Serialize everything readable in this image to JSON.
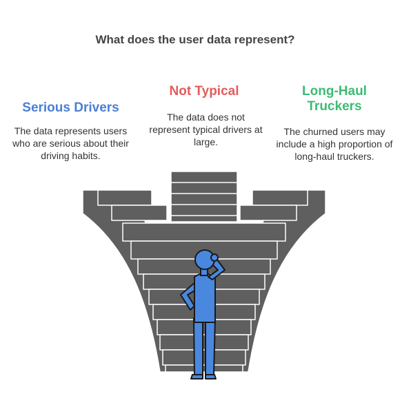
{
  "title": "What does the user data represent?",
  "items": [
    {
      "heading": "Serious Drivers",
      "description": "The data represents users who are serious about their driving habits.",
      "color": "#4a7fd4"
    },
    {
      "heading": "Not Typical",
      "description": "The data does not represent typical drivers at large.",
      "color": "#e25c5c"
    },
    {
      "heading": "Long-Haul Truckers",
      "description": "The churned users may include a high proportion of long-haul truckers.",
      "color": "#3dbb73"
    }
  ],
  "colors": {
    "stairs": "#5f5f5f",
    "edge": "#ffffff",
    "person": "#4a88e0",
    "outline": "#1a1a1a"
  }
}
